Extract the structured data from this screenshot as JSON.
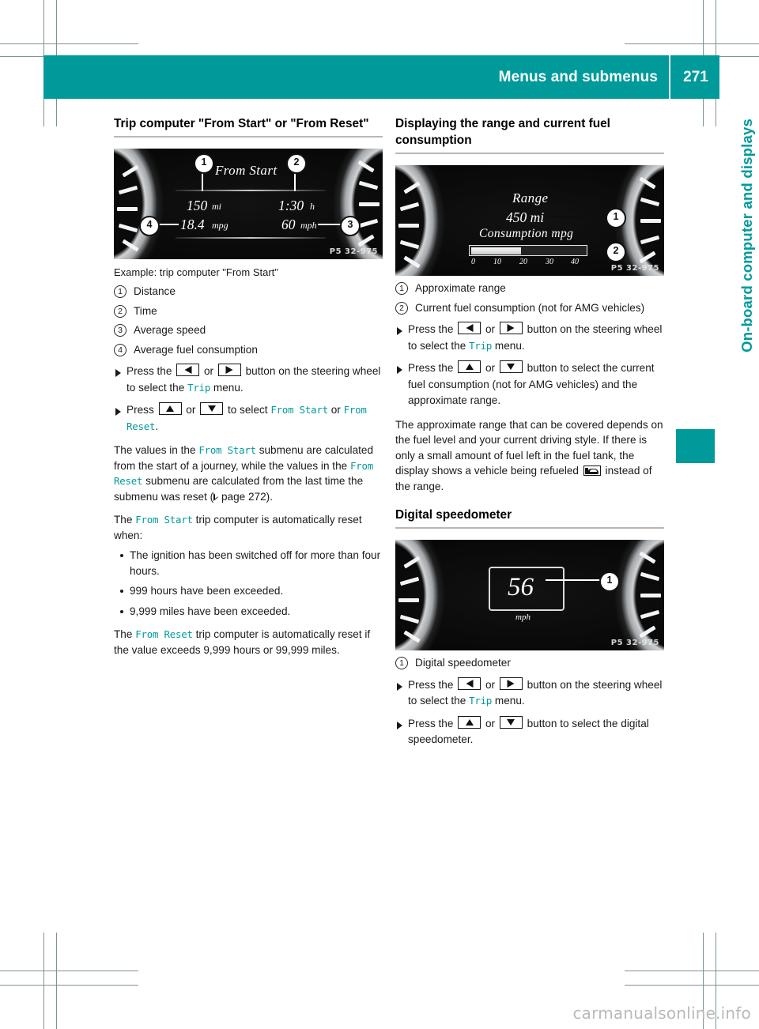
{
  "header": {
    "title": "Menus and submenus",
    "page_number": "271"
  },
  "side_tab": {
    "label": "On-board computer and displays"
  },
  "colors": {
    "accent_teal": "#009a9b",
    "rule_gray": "#b8b8b8",
    "text": "#1a1a1a",
    "watermark": "#b9b9b9"
  },
  "watermark": "carmanualsonline.info",
  "left_column": {
    "heading": "Trip computer \"From Start\" or \"From Reset\"",
    "figure": {
      "code": "P5 32-975",
      "display_title": "From Start",
      "value_distance": "150",
      "unit_distance": "mi",
      "value_time": "1:30",
      "unit_time": "h",
      "value_consumption": "18.4",
      "unit_consumption": "mpg",
      "value_speed": "60",
      "unit_speed": "mph",
      "callouts": [
        "1",
        "2",
        "3",
        "4"
      ]
    },
    "caption": "Example: trip computer \"From Start\"",
    "legend": [
      {
        "num": "1",
        "text": "Distance"
      },
      {
        "num": "2",
        "text": "Time"
      },
      {
        "num": "3",
        "text": "Average speed"
      },
      {
        "num": "4",
        "text": "Average fuel consumption"
      }
    ],
    "steps": [
      {
        "parts": [
          {
            "type": "text",
            "value": "Press the "
          },
          {
            "type": "key",
            "value": "key-left"
          },
          {
            "type": "text",
            "value": " or "
          },
          {
            "type": "key",
            "value": "key-right"
          },
          {
            "type": "text",
            "value": " button on the steering wheel to select the "
          },
          {
            "type": "menu",
            "value": "Trip"
          },
          {
            "type": "text",
            "value": " menu."
          }
        ]
      },
      {
        "parts": [
          {
            "type": "text",
            "value": "Press "
          },
          {
            "type": "key",
            "value": "key-up"
          },
          {
            "type": "text",
            "value": " or "
          },
          {
            "type": "key",
            "value": "key-down"
          },
          {
            "type": "text",
            "value": " to select "
          },
          {
            "type": "menu",
            "value": "From Start"
          },
          {
            "type": "text",
            "value": " or "
          },
          {
            "type": "menu",
            "value": "From Reset"
          },
          {
            "type": "text",
            "value": "."
          }
        ]
      }
    ],
    "para_submenu_1": "The values in the ",
    "menu_from_start": "From Start",
    "para_submenu_2": " submenu are calculated from the start of a journey, while the values in the ",
    "menu_from_reset": "From Reset",
    "para_submenu_3": " submenu are calculated from the last time the submenu was reset (",
    "page_ref": " page 272).",
    "para_auto_reset_1": "The ",
    "para_auto_reset_2": " trip computer is automatically reset when:",
    "bullets": [
      "The ignition has been switched off for more than four hours.",
      "999 hours have been exceeded.",
      "9,999 miles have been exceeded."
    ],
    "para_reset_rule_1": "The ",
    "para_reset_rule_2": " trip computer is automatically reset if the value exceeds 9,999 hours or 99,999 miles."
  },
  "right_column": {
    "heading": "Displaying the range and current fuel consumption",
    "figure": {
      "code": "P5 32-975",
      "label_range": "Range",
      "value_range": "450 mi",
      "label_consumption": "Consumption mpg",
      "scale_ticks": [
        "0",
        "10",
        "20",
        "30",
        "40"
      ],
      "bar_fill_percent": 44,
      "callouts": [
        "1",
        "2"
      ]
    },
    "legend": [
      {
        "num": "1",
        "text": "Approximate range"
      },
      {
        "num": "2",
        "text": "Current fuel consumption (not for AMG vehicles)"
      }
    ],
    "steps": [
      {
        "parts": [
          {
            "type": "text",
            "value": "Press the "
          },
          {
            "type": "key",
            "value": "key-left"
          },
          {
            "type": "text",
            "value": " or "
          },
          {
            "type": "key",
            "value": "key-right"
          },
          {
            "type": "text",
            "value": " button on the steering wheel to select the "
          },
          {
            "type": "menu",
            "value": "Trip"
          },
          {
            "type": "text",
            "value": " menu."
          }
        ]
      },
      {
        "parts": [
          {
            "type": "text",
            "value": "Press the "
          },
          {
            "type": "key",
            "value": "key-up"
          },
          {
            "type": "text",
            "value": " or "
          },
          {
            "type": "key",
            "value": "key-down"
          },
          {
            "type": "text",
            "value": " button to select the current fuel consumption (not for AMG vehicles) and the approximate range."
          }
        ]
      }
    ],
    "para_range_1": "The approximate range that can be covered depends on the fuel level and your current driving style. If there is only a small amount of fuel left in the fuel tank, the display shows a vehicle being refueled ",
    "para_range_2": " instead of the range.",
    "speedo_heading": "Digital speedometer",
    "speedo_figure": {
      "code": "P5 32-975",
      "value": "56",
      "unit": "mph",
      "callouts": [
        "1"
      ]
    },
    "speedo_legend": [
      {
        "num": "1",
        "text": "Digital speedometer"
      }
    ],
    "speedo_steps": [
      {
        "parts": [
          {
            "type": "text",
            "value": "Press the "
          },
          {
            "type": "key",
            "value": "key-left"
          },
          {
            "type": "text",
            "value": " or "
          },
          {
            "type": "key",
            "value": "key-right"
          },
          {
            "type": "text",
            "value": " button on the steering wheel to select the "
          },
          {
            "type": "menu",
            "value": "Trip"
          },
          {
            "type": "text",
            "value": " menu."
          }
        ]
      },
      {
        "parts": [
          {
            "type": "text",
            "value": "Press the "
          },
          {
            "type": "key",
            "value": "key-up"
          },
          {
            "type": "text",
            "value": " or "
          },
          {
            "type": "key",
            "value": "key-down"
          },
          {
            "type": "text",
            "value": " button to select the digital speedometer."
          }
        ]
      }
    ]
  }
}
